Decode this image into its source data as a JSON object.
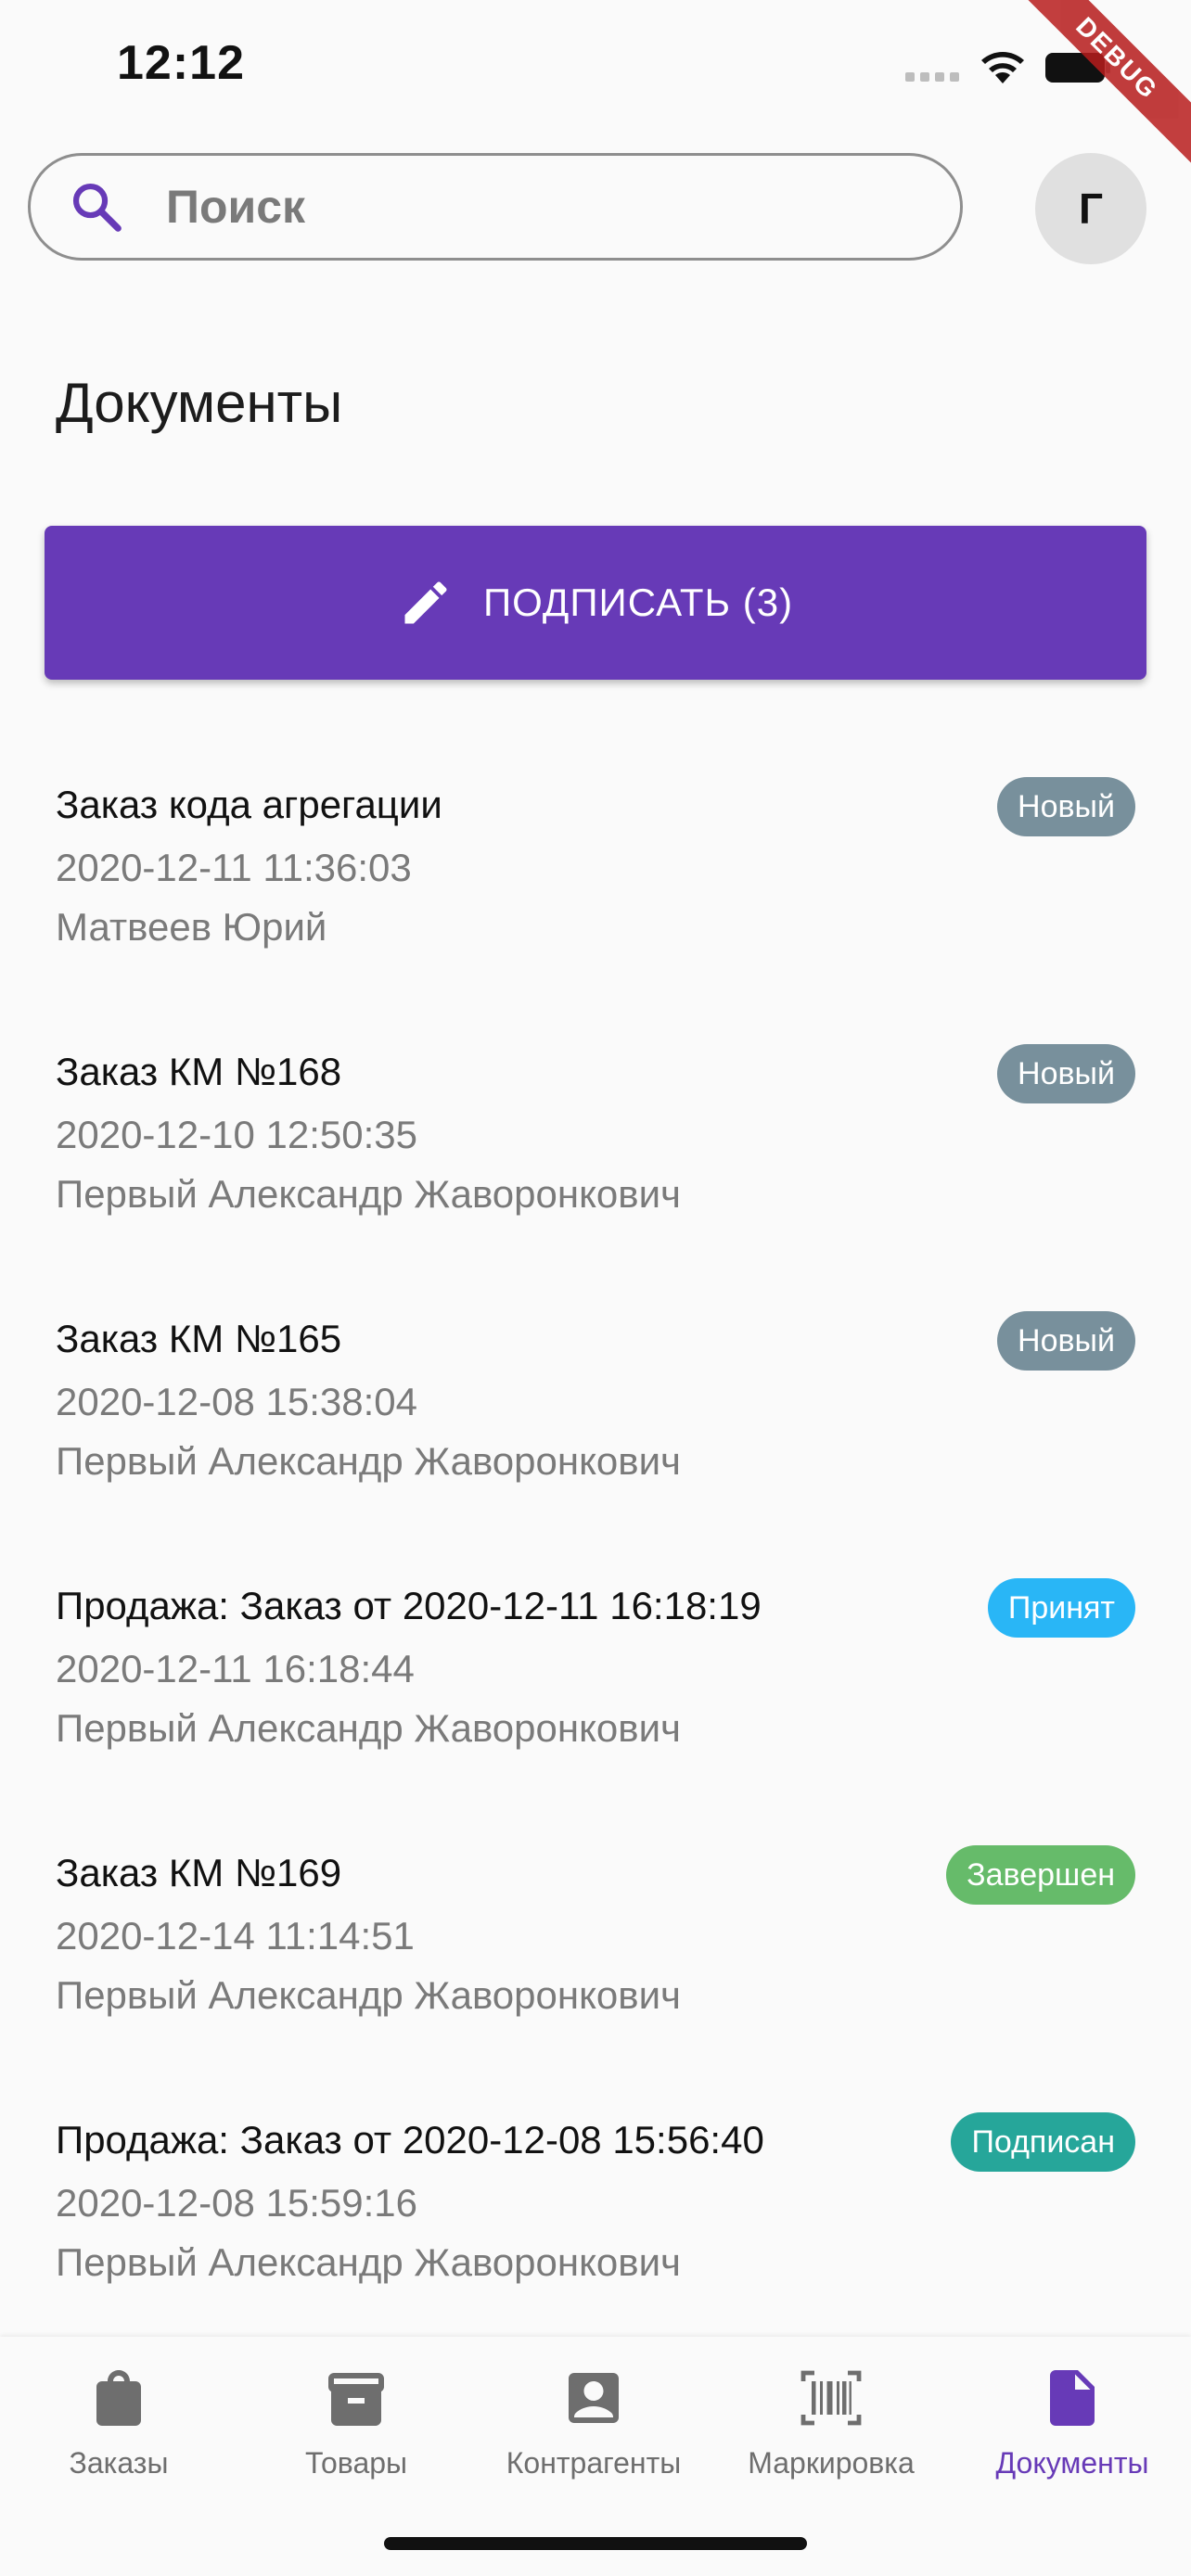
{
  "status": {
    "time": "12:12",
    "debug": "DEBUG"
  },
  "search": {
    "placeholder": "Поиск"
  },
  "avatar": {
    "initial": "Г"
  },
  "page_title": "Документы",
  "sign_button": {
    "label": "ПОДПИСАТЬ (3)"
  },
  "documents": [
    {
      "title": "Заказ кода агрегации",
      "date": "2020-12-11 11:36:03",
      "author": "Матвеев Юрий",
      "status": "Новый",
      "status_color": "#78909c"
    },
    {
      "title": "Заказ КМ №168",
      "date": "2020-12-10 12:50:35",
      "author": "Первый Александр Жаворонкович",
      "status": "Новый",
      "status_color": "#78909c"
    },
    {
      "title": "Заказ КМ №165",
      "date": "2020-12-08 15:38:04",
      "author": "Первый Александр Жаворонкович",
      "status": "Новый",
      "status_color": "#78909c"
    },
    {
      "title": "Продажа: Заказ от 2020-12-11 16:18:19",
      "date": "2020-12-11 16:18:44",
      "author": "Первый Александр Жаворонкович",
      "status": "Принят",
      "status_color": "#29b6f6"
    },
    {
      "title": "Заказ КМ №169",
      "date": "2020-12-14 11:14:51",
      "author": "Первый Александр Жаворонкович",
      "status": "Завершен",
      "status_color": "#66bb6a"
    },
    {
      "title": "Продажа: Заказ от 2020-12-08 15:56:40",
      "date": "2020-12-08 15:59:16",
      "author": "Первый Александр Жаворонкович",
      "status": "Подписан",
      "status_color": "#26a69a"
    }
  ],
  "nav": {
    "items": [
      {
        "label": "Заказы",
        "icon": "shopping-bag-icon"
      },
      {
        "label": "Товары",
        "icon": "box-icon"
      },
      {
        "label": "Контрагенты",
        "icon": "contact-icon"
      },
      {
        "label": "Маркировка",
        "icon": "barcode-icon"
      },
      {
        "label": "Документы",
        "icon": "document-icon"
      }
    ],
    "active_index": 4,
    "active_color": "#673ab7"
  },
  "colors": {
    "primary": "#673ab7",
    "background": "#fafafa"
  }
}
